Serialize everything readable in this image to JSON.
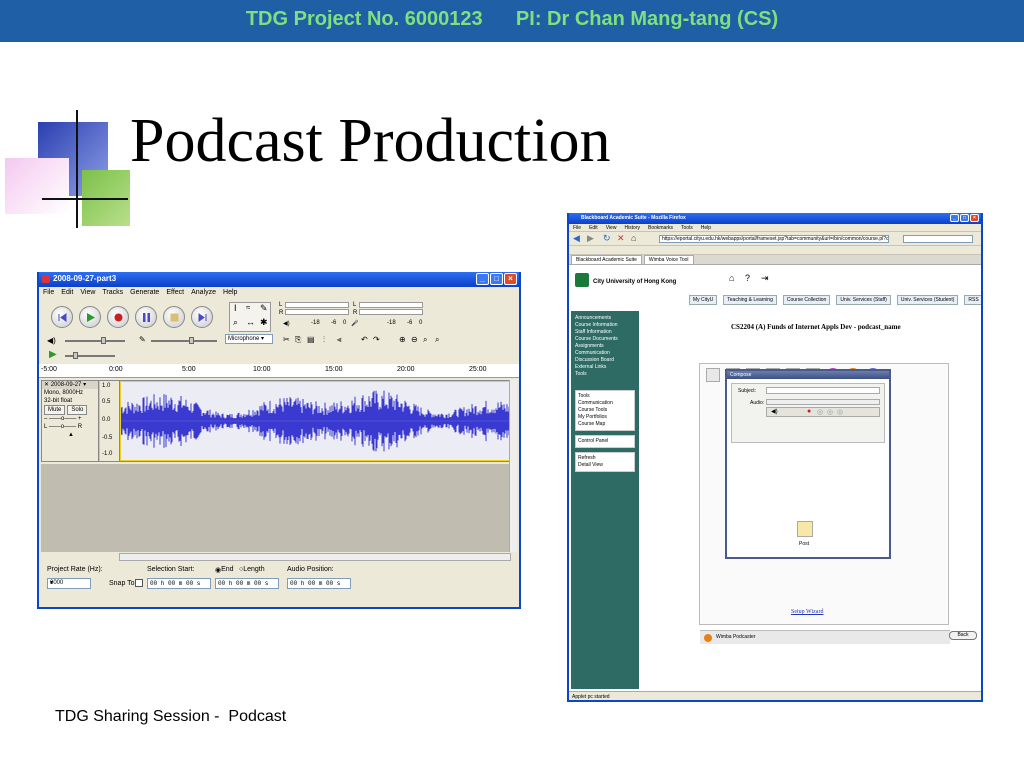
{
  "slide": {
    "header": "TDG Project No. 6000123      PI: Dr Chan Mang-tang (CS)",
    "title": "Podcast Production",
    "footer": "TDG Sharing Session -  Podcast",
    "colors": {
      "header_bg": "#1f5fa6",
      "header_text": "#7ee07e"
    }
  },
  "audacity": {
    "window_title": "2008-09-27-part3",
    "menu": [
      "File",
      "Edit",
      "View",
      "Tracks",
      "Generate",
      "Effect",
      "Analyze",
      "Help"
    ],
    "meter_labels": {
      "l": "L",
      "r": "R",
      "db18": "-18",
      "db6": "-6",
      "zero": "0"
    },
    "input_source": "Microphone",
    "ruler_ticks": [
      "-5:00",
      "0:00",
      "5:00",
      "10:00",
      "15:00",
      "20:00",
      "25:00"
    ],
    "track": {
      "name": "2008-09-27",
      "info1": "Mono, 8000Hz",
      "info2": "32-bit float",
      "mute": "Mute",
      "solo": "Solo",
      "scale": [
        "1.0",
        "0.5",
        "0.0",
        "-0.5",
        "-1.0"
      ]
    },
    "status": {
      "project_rate_label": "Project Rate (Hz):",
      "project_rate": "8000",
      "snap_to": "Snap To",
      "selection_start": "Selection Start:",
      "end_label": "End",
      "length_label": "Length",
      "audio_position": "Audio Position:",
      "time1": "00 h 00 m 00 s",
      "time2": "00 h 00 m 00 s",
      "time3": "00 h 00 m 00 s"
    }
  },
  "browser": {
    "window_title": "Blackboard Academic Suite - Mozilla Firefox",
    "menu": [
      "File",
      "Edit",
      "View",
      "History",
      "Bookmarks",
      "Tools",
      "Help"
    ],
    "url": "https://eportal.cityu.edu.hk/webapps/portal/frameset.jsp?tab=community&url=/bin/common/course.pl?cour",
    "tabs": [
      "Blackboard Academic Suite",
      "Wimba Voice Tool"
    ],
    "university": "City University of Hong Kong",
    "nav_tabs": [
      "My CityU",
      "Teaching & Learning",
      "Course Collection",
      "Univ. Services (Staff)",
      "Univ. Services (Student)",
      "RSS"
    ],
    "sidebar": [
      "Announcements",
      "Course Information",
      "Staff Information",
      "Course Documents",
      "Assignments",
      "Communication",
      "Discussion Board",
      "External Links",
      "Tools"
    ],
    "tools_title": "Tools",
    "tools_items": [
      "Communication",
      "Course Tools",
      "My Portfolios",
      "Course Map",
      "Control Panel",
      "Refresh",
      "Detail View"
    ],
    "course_title": "CS2204 (A) Funds of Internet Appls Dev - podcast_name",
    "compose": {
      "title": "Compose",
      "subject": "Subject:",
      "audio": "Audio:",
      "post": "Post"
    },
    "wimba": "Wimba Podcaster",
    "setup_wizard": "Setup Wizard",
    "back": "Back",
    "status": "Applet pc started"
  }
}
